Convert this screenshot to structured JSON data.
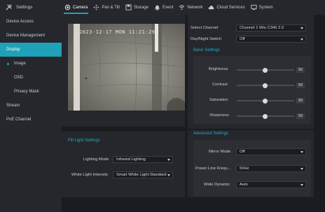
{
  "app": {
    "title": "Settings"
  },
  "sidebar": {
    "items": [
      {
        "label": "Device Access"
      },
      {
        "label": "Device Management"
      },
      {
        "label": "Display"
      },
      {
        "label": "Image"
      },
      {
        "label": "OSD"
      },
      {
        "label": "Privacy Mask"
      },
      {
        "label": "Stream"
      },
      {
        "label": "PoE Channel"
      }
    ]
  },
  "tabs": [
    {
      "label": "Camera",
      "icon": "camera-icon"
    },
    {
      "label": "Pan & Tilt",
      "icon": "pan-tilt-icon"
    },
    {
      "label": "Storage",
      "icon": "storage-icon"
    },
    {
      "label": "Event",
      "icon": "bell-icon"
    },
    {
      "label": "Network",
      "icon": "wifi-icon"
    },
    {
      "label": "Cloud Services",
      "icon": "cloud-icon"
    },
    {
      "label": "System",
      "icon": "monitor-icon"
    }
  ],
  "video": {
    "timestamp": "2023-12-17 MON 11:21:29"
  },
  "channel": {
    "label": "Select Channel",
    "value": "Channel 1 Wio C340 2.0"
  },
  "daynight": {
    "label": "Day/Night Switch",
    "value": "Off"
  },
  "basic": {
    "title": "Basic Settings",
    "sliders": [
      {
        "label": "Brightness",
        "value": 50
      },
      {
        "label": "Contrast",
        "value": 50
      },
      {
        "label": "Saturation",
        "value": 50
      },
      {
        "label": "Sharpness",
        "value": 50
      }
    ]
  },
  "fill_light": {
    "title": "Fill Light Settings",
    "lighting_mode": {
      "label": "Lighting Mode",
      "value": "Infrared Lighting"
    },
    "white_light": {
      "label": "White Light Intensity",
      "value": "Smart White Light-Standard"
    }
  },
  "advanced": {
    "title": "Advanced Settings",
    "mirror": {
      "label": "Mirror Mode",
      "value": "Off"
    },
    "powerline": {
      "label": "Power Line Frequ...",
      "value": "50Hz"
    },
    "wdr": {
      "label": "Wide Dynamic",
      "value": "Auto"
    }
  },
  "colors": {
    "accent": "#1fa1b8",
    "bg": "#1b1c20",
    "panel": "#25272c"
  }
}
